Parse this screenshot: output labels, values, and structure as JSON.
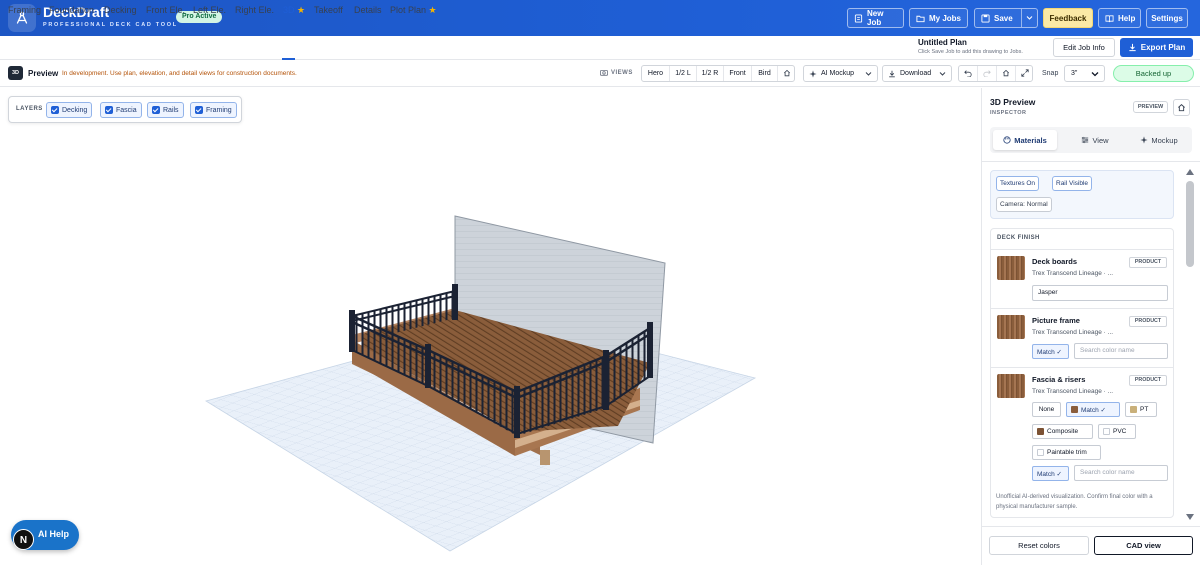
{
  "app": {
    "name": "DeckDraft",
    "tagline": "PROFESSIONAL DECK CAD TOOL",
    "plan_badge": "Pro Active",
    "accent": "#1f5fd6"
  },
  "header_buttons": {
    "new_job": "New Job",
    "my_jobs": "My Jobs",
    "save": "Save",
    "feedback": "Feedback",
    "help": "Help",
    "settings": "Settings"
  },
  "tabs": [
    {
      "label": "Framing"
    },
    {
      "label": "Foundation"
    },
    {
      "label": "Decking"
    },
    {
      "label": "Front Ele."
    },
    {
      "label": "Left Ele."
    },
    {
      "label": "Right Ele."
    },
    {
      "label": "3D",
      "starred": true,
      "active": true
    },
    {
      "label": "Takeoff"
    },
    {
      "label": "Details"
    },
    {
      "label": "Plot Plan",
      "starred": true
    }
  ],
  "job": {
    "title": "Untitled Plan",
    "subtitle": "Click Save Job to add this drawing to Jobs.",
    "job_info_label": "Edit Job Info",
    "export_label": "Export Plan"
  },
  "toolbar": {
    "badge": "3D",
    "mode_label": "Preview",
    "dev_note": "In development. Use plan, elevation, and detail views for construction documents.",
    "views_label": "VIEWS",
    "view_presets": [
      "Hero",
      "1/2 L",
      "1/2 R",
      "Front",
      "Bird"
    ],
    "ai_mockup_label": "AI Mockup",
    "download_label": "Download",
    "snap_label": "Snap",
    "snap_value": "3\"",
    "backup_status": "Backed up"
  },
  "layers": {
    "label": "LAYERS",
    "items": [
      {
        "label": "Decking",
        "checked": true
      },
      {
        "label": "Fascia",
        "checked": true
      },
      {
        "label": "Rails",
        "checked": true
      },
      {
        "label": "Framing",
        "checked": true
      }
    ]
  },
  "ai_help": {
    "label": "AI Help",
    "avatar_letter": "N"
  },
  "inspector": {
    "title": "3D Preview",
    "subtitle": "INSPECTOR",
    "badge": "PREVIEW",
    "tabs": [
      {
        "label": "Materials",
        "active": true
      },
      {
        "label": "View"
      },
      {
        "label": "Mockup"
      }
    ],
    "toggles": [
      "Textures On",
      "Rail Visible",
      "Camera: Normal"
    ],
    "section_title": "DECK FINISH",
    "materials": [
      {
        "name": "Deck boards",
        "product": "Trex Transcend Lineage · ...",
        "badge": "PRODUCT",
        "color_value": "Jasper"
      },
      {
        "name": "Picture frame",
        "product": "Trex Transcend Lineage · ...",
        "badge": "PRODUCT",
        "match_label": "Match ✓",
        "search_placeholder": "Search color name"
      },
      {
        "name": "Fascia & risers",
        "product": "Trex Transcend Lineage · ...",
        "badge": "PRODUCT",
        "options": [
          "None",
          "Match ✓",
          "PT",
          "Composite",
          "PVC",
          "Paintable trim"
        ],
        "match_label": "Match ✓",
        "search_placeholder": "Search color name"
      }
    ],
    "disclaimer": "Unofficial AI-derived visualization. Confirm final color with a physical manufacturer sample.",
    "reset_label": "Reset colors",
    "cad_label": "CAD view"
  },
  "colors": {
    "railing": "#1b2233",
    "deck_board": "#8a5d3b",
    "fascia": "#a0704c",
    "wall": "#c9cfd6",
    "ground_grid": "#e6eef8",
    "backed_up": "#dcfce7"
  }
}
